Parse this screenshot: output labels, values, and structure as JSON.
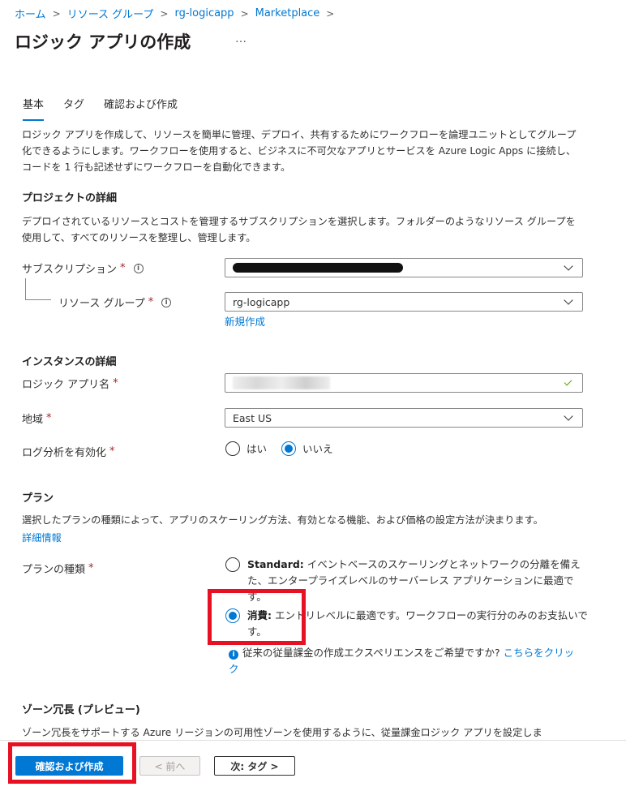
{
  "breadcrumb": [
    "ホーム",
    "リソース グループ",
    "rg-logicapp",
    "Marketplace"
  ],
  "page_title": "ロジック アプリの作成",
  "more_label": "…",
  "tabs": {
    "basic": "基本",
    "tags": "タグ",
    "review": "確認および作成"
  },
  "intro": "ロジック アプリを作成して、リソースを簡単に管理、デプロイ、共有するためにワークフローを論理ユニットとしてグループ化できるようにします。ワークフローを使用すると、ビジネスに不可欠なアプリとサービスを Azure Logic Apps に接続し、コードを 1 行も記述せずにワークフローを自動化できます。",
  "project": {
    "heading": "プロジェクトの詳細",
    "desc": "デプロイされているリソースとコストを管理するサブスクリプションを選択します。フォルダーのようなリソース グループを使用して、すべてのリソースを整理し、管理します。",
    "subscription_label": "サブスクリプション",
    "resource_group_label": "リソース グループ",
    "resource_group_value": "rg-logicapp",
    "new_link": "新規作成"
  },
  "required_mark": "*",
  "info_glyph": "i",
  "instance": {
    "heading": "インスタンスの詳細",
    "name_label": "ロジック アプリ名",
    "region_label": "地域",
    "region_value": "East US",
    "log_label": "ログ分析を有効化",
    "log_yes": "はい",
    "log_no": "いいえ"
  },
  "plan": {
    "heading": "プラン",
    "desc": "選択したプランの種類によって、アプリのスケーリング方法、有効となる機能、および価格の設定方法が決まります。",
    "more_link": "詳細情報",
    "type_label": "プランの種類",
    "standard_name": "Standard:",
    "standard_desc": "イベントベースのスケーリングとネットワークの分離を備えた、エンタープライズレベルのサーバーレス アプリケーションに最適です。",
    "consumption_name": "消費:",
    "consumption_desc": "エントリレベルに最適です。ワークフローの実行分のみのお支払いです。",
    "legacy_note": "従来の従量課金の作成エクスペリエンスをご希望ですか?",
    "legacy_link": "こちらをクリック"
  },
  "zone": {
    "heading": "ゾーン冗長 (プレビュー)",
    "desc": "ゾーン冗長をサポートする Azure リージョンの可用性ゾーンを使用するように、従量課金ロジック アプリを設定しま"
  },
  "footer": {
    "review_create": "確認および作成",
    "prev": "< 前へ",
    "next": "次: タグ >"
  }
}
